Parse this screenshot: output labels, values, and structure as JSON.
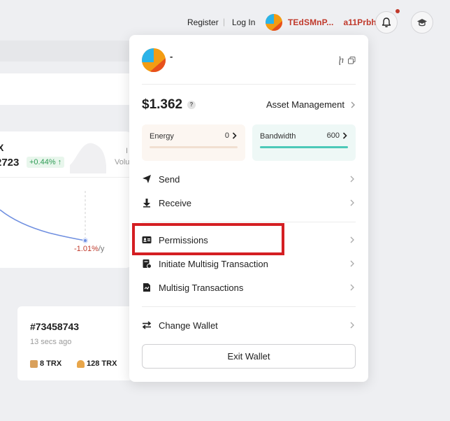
{
  "nav": {
    "register": "Register",
    "separator": "|",
    "login": "Log In",
    "wallet_address_start": "TEdSMnP...",
    "wallet_address_end": "a11Prbh"
  },
  "background": {
    "token_fragment": "X",
    "price_fragment": "2723",
    "change": "+0.44% ↑",
    "volume_fragment": "Volu",
    "volume_fragment_top": "I",
    "rate": "-1.01%",
    "rate_unit": "/y",
    "block_number": "#73458743",
    "block_time": "13 secs ago",
    "block_stat_1": "8 TRX",
    "block_stat_2": "128 TRX"
  },
  "panel": {
    "account_name": "-",
    "balance": "$1.362",
    "help": "?",
    "asset_management": "Asset Management",
    "energy": {
      "label": "Energy",
      "value": "0"
    },
    "bandwidth": {
      "label": "Bandwidth",
      "value": "600"
    },
    "menu": {
      "send": "Send",
      "receive": "Receive",
      "permissions": "Permissions",
      "initiate_multisig": "Initiate Multisig Transaction",
      "multisig_transactions": "Multisig Transactions",
      "change_wallet": "Change Wallet"
    },
    "exit_wallet": "Exit Wallet"
  },
  "colors": {
    "accent_red": "#c0392b",
    "highlight_red": "#d41e22",
    "bandwidth_teal": "#4cc9b8",
    "positive_green": "#2e9c55"
  },
  "icons": [
    "bell-icon",
    "graduation-cap-icon",
    "send-icon",
    "receive-icon",
    "permissions-icon",
    "multisig-icon",
    "transactions-icon",
    "change-wallet-icon",
    "copy-icon",
    "chevron-right-icon"
  ]
}
